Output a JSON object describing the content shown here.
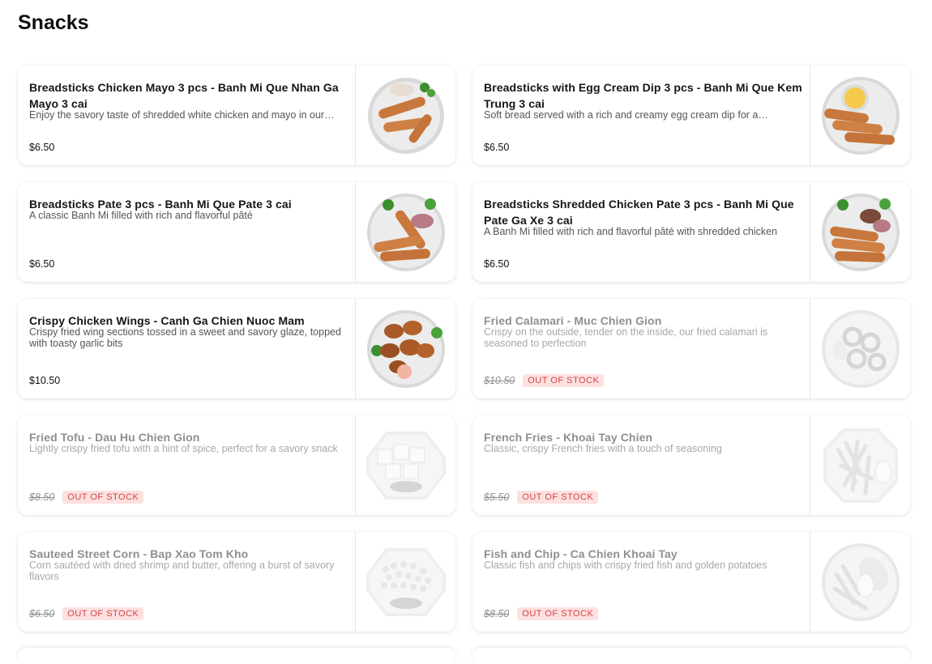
{
  "section": {
    "title": "Snacks"
  },
  "items": [
    {
      "name": "Breadsticks Chicken Mayo 3 pcs - Banh Mi Que Nhan Ga Mayo 3 cai",
      "description": "Enjoy the savory taste of shredded white chicken and mayo in our…",
      "price": "$6.50",
      "badge": ""
    },
    {
      "name": "Breadsticks with Egg Cream Dip 3 pcs - Banh Mi Que Kem Trung 3 cai",
      "description": "Soft bread served with a rich and creamy egg cream dip for a…",
      "price": "$6.50",
      "badge": ""
    },
    {
      "name": "Breadsticks Pate 3 pcs - Banh Mi Que Pate 3 cai",
      "description": "A classic Banh Mi filled with rich and flavorful pâté",
      "price": "$6.50",
      "badge": ""
    },
    {
      "name": "Breadsticks Shredded Chicken Pate 3 pcs - Banh Mi Que Pate Ga Xe 3 cai",
      "description": "A Banh Mi filled with rich and flavorful pâté with shredded chicken",
      "price": "$6.50",
      "badge": ""
    },
    {
      "name": "Crispy Chicken Wings - Canh Ga Chien Nuoc Mam",
      "description": "Crispy fried wing sections tossed in a sweet and savory glaze, topped with toasty garlic bits",
      "price": "$10.50",
      "badge": ""
    },
    {
      "name": "Fried Calamari - Muc Chien Gion",
      "description": "Crispy on the outside, tender on the inside, our fried calamari is seasoned to perfection",
      "price": "$10.50",
      "badge": "OUT OF STOCK"
    },
    {
      "name": "Fried Tofu - Dau Hu Chien Gion",
      "description": "Lightly crispy fried tofu with a hint of spice, perfect for a savory snack",
      "price": "$8.50",
      "badge": "OUT OF STOCK"
    },
    {
      "name": "French Fries - Khoai Tay Chien",
      "description": "Classic, crispy French fries with a touch of seasoning",
      "price": "$5.50",
      "badge": "OUT OF STOCK"
    },
    {
      "name": "Sauteed Street Corn - Bap Xao Tom Kho",
      "description": "Corn sautéed with dried shrimp and butter, offering a burst of savory flavors",
      "price": "$6.50",
      "badge": "OUT OF STOCK"
    },
    {
      "name": "Fish and Chip - Ca Chien Khoai Tay",
      "description": "Classic fish and chips with crispy fried fish and golden potatoes",
      "price": "$8.50",
      "badge": "OUT OF STOCK"
    }
  ]
}
